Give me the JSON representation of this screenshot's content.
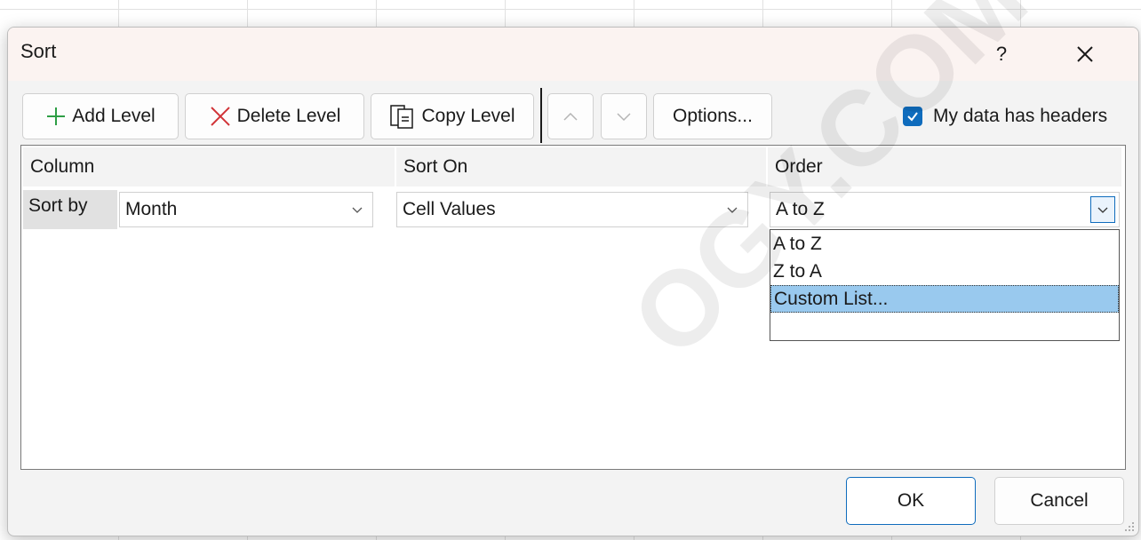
{
  "dialog": {
    "title": "Sort",
    "help_label": "?",
    "close_label": "×"
  },
  "toolbar": {
    "add_level": "Add Level",
    "delete_level": "Delete Level",
    "copy_level": "Copy Level",
    "move_up": "^",
    "move_down": "v",
    "options": "Options...",
    "headers_checkbox": {
      "label": "My data has headers",
      "checked": true
    }
  },
  "grid": {
    "headers": [
      "Column",
      "Sort On",
      "Order"
    ],
    "row": {
      "label": "Sort by",
      "column_value": "Month",
      "sort_on_value": "Cell Values",
      "order_value": "A to Z"
    }
  },
  "order_dropdown": {
    "options": [
      "A to Z",
      "Z to A",
      "Custom List..."
    ],
    "highlighted_index": 2
  },
  "footer": {
    "ok": "OK",
    "cancel": "Cancel"
  },
  "watermark": "OGY.COM",
  "colors": {
    "accent": "#0f6cbd",
    "highlight": "#99c9ee",
    "add_icon": "#2e9e45",
    "delete_icon": "#d13438"
  }
}
